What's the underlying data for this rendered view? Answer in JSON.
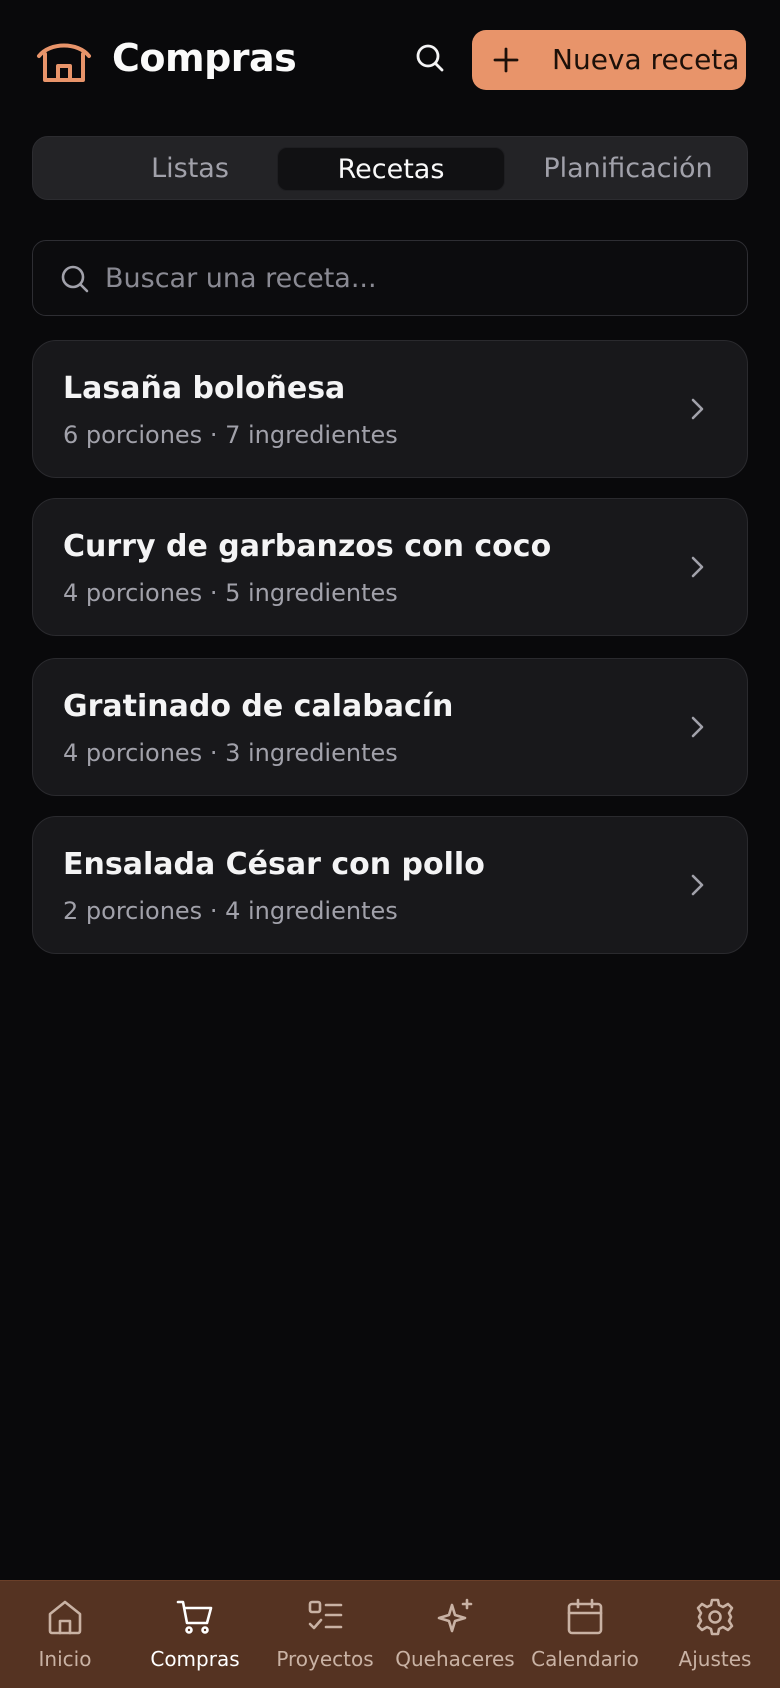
{
  "header": {
    "title": "Compras",
    "logo_icon": "house-icon",
    "search_icon": "search-icon",
    "new_button_label": "Nueva receta",
    "new_button_icon": "plus-icon",
    "accent_color": "#e8946a"
  },
  "tabs": [
    {
      "label": "Listas",
      "active": false
    },
    {
      "label": "Recetas",
      "active": true
    },
    {
      "label": "Planificación",
      "active": false
    }
  ],
  "search": {
    "placeholder": "Buscar una receta...",
    "value": ""
  },
  "recipes": [
    {
      "name": "Lasaña boloñesa",
      "meta": "6 porciones · 7 ingredientes"
    },
    {
      "name": "Curry de garbanzos con coco",
      "meta": "4 porciones · 5 ingredientes"
    },
    {
      "name": "Gratinado de calabacín",
      "meta": "4 porciones · 3 ingredientes"
    },
    {
      "name": "Ensalada César con pollo",
      "meta": "2 porciones · 4 ingredientes"
    }
  ],
  "bottom_nav": [
    {
      "label": "Inicio",
      "icon": "home-icon",
      "active": false
    },
    {
      "label": "Compras",
      "icon": "cart-icon",
      "active": true
    },
    {
      "label": "Proyectos",
      "icon": "checklist-icon",
      "active": false
    },
    {
      "label": "Quehaceres",
      "icon": "sparkles-icon",
      "active": false
    },
    {
      "label": "Calendario",
      "icon": "calendar-icon",
      "active": false
    },
    {
      "label": "Ajustes",
      "icon": "gear-icon",
      "active": false
    }
  ]
}
